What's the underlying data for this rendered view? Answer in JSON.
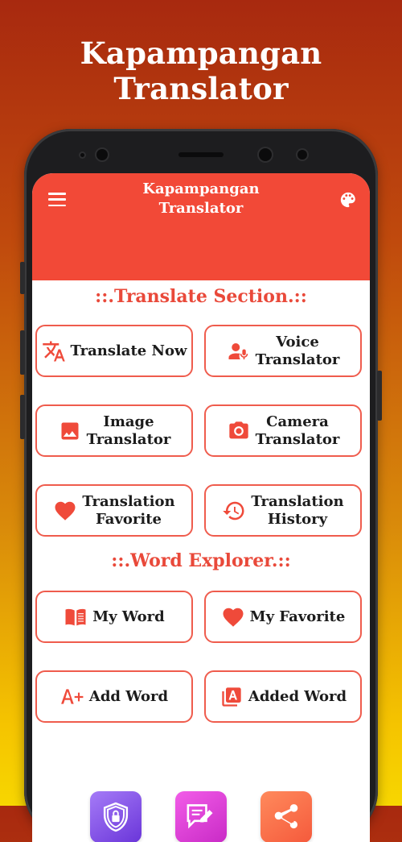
{
  "banner": {
    "title": "Kapampangan Translator"
  },
  "app_bar": {
    "title_line1": "Kapampangan",
    "title_line2": "Translator"
  },
  "sections": {
    "translate_title": "::.Translate Section.::",
    "explorer_title": "::.Word Explorer.::"
  },
  "cards": {
    "translate_now": {
      "label": "Translate Now",
      "icon": "translate-icon"
    },
    "voice": {
      "line1": "Voice",
      "line2": "Translator",
      "icon": "voice-person-icon"
    },
    "image": {
      "line1": "Image",
      "line2": "Translator",
      "icon": "image-icon"
    },
    "camera": {
      "line1": "Camera",
      "line2": "Translator",
      "icon": "camera-icon"
    },
    "favorite": {
      "line1": "Translation",
      "line2": "Favorite",
      "icon": "heart-icon"
    },
    "history": {
      "line1": "Translation",
      "line2": "History",
      "icon": "history-icon"
    },
    "my_word": {
      "label": "My Word",
      "icon": "book-icon"
    },
    "my_favorite": {
      "label": "My Favorite",
      "icon": "heart-icon"
    },
    "add_word": {
      "label": "Add Word",
      "icon": "a-plus-icon"
    },
    "added_word": {
      "label": "Added Word",
      "icon": "letter-a-stack-icon"
    }
  },
  "bottom_tiles": [
    {
      "name": "privacy",
      "icon": "shield-lock-icon"
    },
    {
      "name": "feedback",
      "icon": "chat-pencil-icon"
    },
    {
      "name": "share",
      "icon": "share-icon"
    }
  ],
  "colors": {
    "accent": "#f24937",
    "card_border": "#ef5c4d",
    "section_title": "#e9493a",
    "tile_privacy": "#8a4ff0",
    "tile_feedback": "#e33fd6",
    "tile_share": "#fb6b4a"
  }
}
